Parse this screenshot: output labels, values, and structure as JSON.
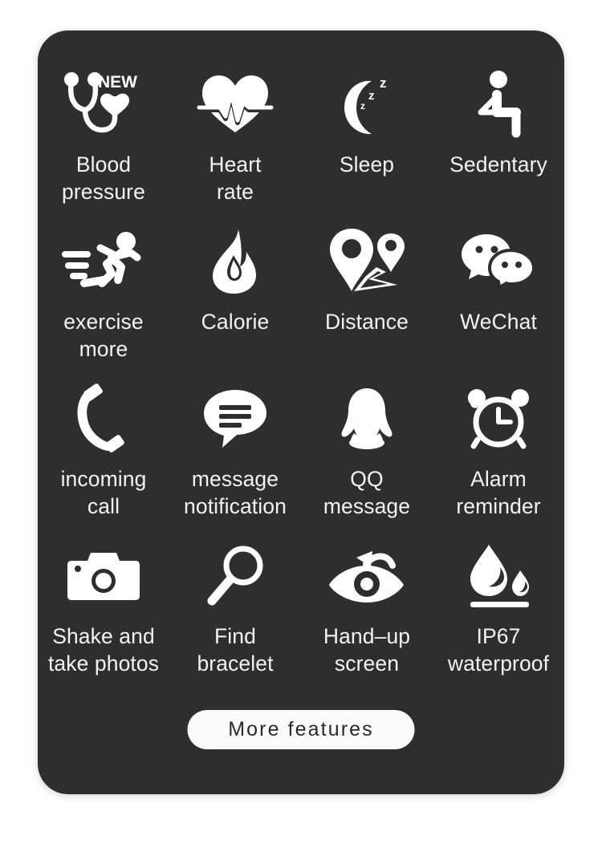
{
  "card": {
    "background_color": "#2e2e2e",
    "corner_radius_px": 38
  },
  "features": [
    {
      "icon": "stethoscope-heart-icon",
      "badge": "NEW",
      "label": "Blood\npressure"
    },
    {
      "icon": "heart-ecg-icon",
      "badge": "",
      "label": "Heart\nrate"
    },
    {
      "icon": "crescent-moon-zzz-icon",
      "badge": "",
      "label": "Sleep"
    },
    {
      "icon": "seated-person-icon",
      "badge": "",
      "label": "Sedentary"
    },
    {
      "icon": "running-person-icon",
      "badge": "",
      "label": "exercise\nmore"
    },
    {
      "icon": "flame-icon",
      "badge": "",
      "label": "Calorie"
    },
    {
      "icon": "map-pins-route-icon",
      "badge": "",
      "label": "Distance"
    },
    {
      "icon": "wechat-bubbles-icon",
      "badge": "",
      "label": "WeChat"
    },
    {
      "icon": "phone-handset-icon",
      "badge": "",
      "label": "incoming\ncall"
    },
    {
      "icon": "message-bubble-icon",
      "badge": "",
      "label": "message\nnotification"
    },
    {
      "icon": "qq-penguin-icon",
      "badge": "",
      "label": "QQ\nmessage"
    },
    {
      "icon": "alarm-clock-icon",
      "badge": "",
      "label": "Alarm\nreminder"
    },
    {
      "icon": "camera-icon",
      "badge": "",
      "label": "Shake and\ntake photos"
    },
    {
      "icon": "magnifier-icon",
      "badge": "",
      "label": "Find\nbracelet"
    },
    {
      "icon": "eye-raise-arrow-icon",
      "badge": "",
      "label": "Hand–up\nscreen"
    },
    {
      "icon": "water-drops-icon",
      "badge": "",
      "label": "IP67\nwaterproof"
    }
  ],
  "more_button": {
    "label": "More features",
    "background_color": "#fbfbfb",
    "text_color": "#2a2a2a"
  },
  "colors": {
    "page_background": "#ffffff",
    "card_background": "#2e2e2e",
    "icon_color": "#ffffff",
    "label_color": "#f2f2f2"
  }
}
